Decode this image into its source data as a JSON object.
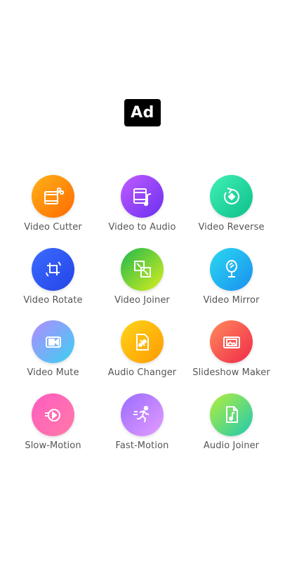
{
  "ad": {
    "label": "Ad"
  },
  "tools": [
    {
      "label": "Video Cutter",
      "icon": "film-scissors-icon"
    },
    {
      "label": "Video to Audio",
      "icon": "film-music-icon"
    },
    {
      "label": "Video Reverse",
      "icon": "rotate-reverse-icon"
    },
    {
      "label": "Video Rotate",
      "icon": "crop-rotate-icon"
    },
    {
      "label": "Video Joiner",
      "icon": "join-squares-icon"
    },
    {
      "label": "Video Mirror",
      "icon": "mirror-icon"
    },
    {
      "label": "Video Mute",
      "icon": "video-camera-icon"
    },
    {
      "label": "Audio Changer",
      "icon": "file-audio-icon"
    },
    {
      "label": "Slideshow Maker",
      "icon": "slideshow-icon"
    },
    {
      "label": "Slow-Motion",
      "icon": "slow-motion-icon"
    },
    {
      "label": "Fast-Motion",
      "icon": "running-icon"
    },
    {
      "label": "Audio Joiner",
      "icon": "audio-file-icon"
    }
  ],
  "colors": {
    "background": "#ffffff",
    "label_text": "#555555",
    "ad_background": "#000000"
  }
}
